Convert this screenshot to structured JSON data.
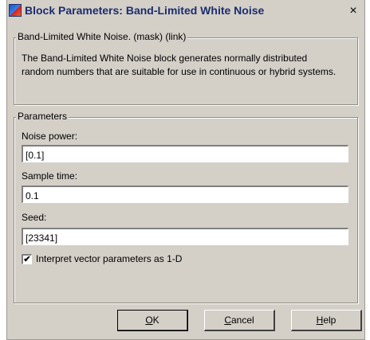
{
  "window": {
    "title": "Block Parameters: Band-Limited White Noise",
    "close_glyph": "×"
  },
  "description_group": {
    "legend": "Band-Limited White Noise. (mask) (link)",
    "text": "The Band-Limited White Noise block generates normally distributed random numbers that are suitable for use in continuous or hybrid systems."
  },
  "parameters_group": {
    "legend": "Parameters",
    "fields": [
      {
        "label": "Noise power:",
        "value": "[0.1]"
      },
      {
        "label": "Sample time:",
        "value": "0.1"
      },
      {
        "label": "Seed:",
        "value": "[23341]"
      }
    ],
    "checkbox": {
      "label": "Interpret vector parameters as 1-D",
      "checked": true,
      "mark": "✔"
    }
  },
  "buttons": {
    "ok_mnemonic": "O",
    "ok_rest": "K",
    "cancel_mnemonic": "C",
    "cancel_rest": "ancel",
    "help_mnemonic": "H",
    "help_rest": "elp"
  }
}
